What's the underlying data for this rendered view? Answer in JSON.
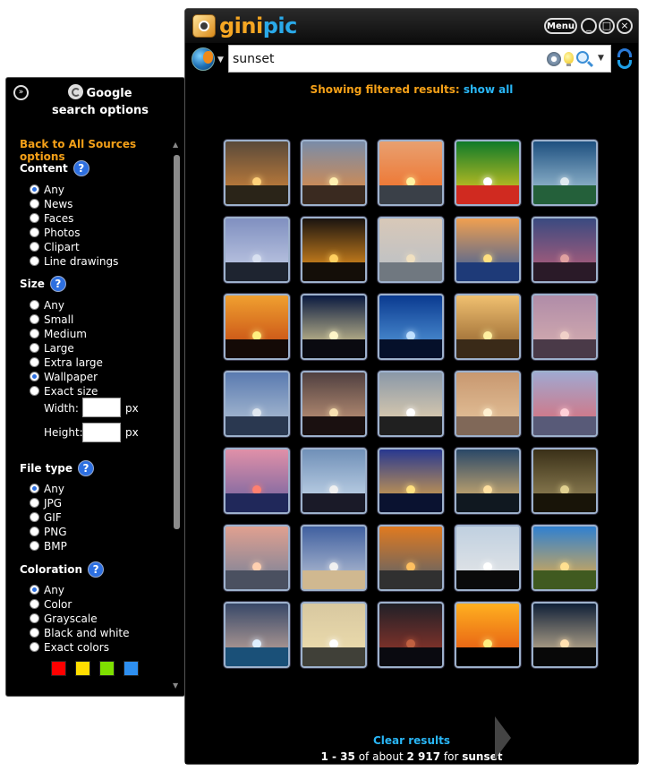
{
  "app": {
    "brand_part1": "gini",
    "brand_part2": "pic",
    "menu_label": "Menu",
    "minimize_glyph": "_",
    "maximize_glyph": "□",
    "close_glyph": "×"
  },
  "search": {
    "query": "sunset",
    "placeholder": ""
  },
  "results": {
    "filter_text": "Showing filtered results: ",
    "show_all": "show all",
    "clear_results": "Clear results",
    "summary_prefix": "1 - 35",
    "summary_middle": " of about ",
    "summary_count": "2 917",
    "summary_for": " for ",
    "summary_query": "sunset",
    "thumbnails": [
      {
        "sky": [
          "#5a4a3a",
          "#d9893b"
        ],
        "fg": "#2a2418",
        "sun": "#ffd27a"
      },
      {
        "sky": [
          "#7a8ca8",
          "#e88a3a"
        ],
        "fg": "#3a2a20",
        "sun": "#fff0b0"
      },
      {
        "sky": [
          "#e8a070",
          "#f06a20"
        ],
        "fg": "#3a4048",
        "sun": "#fff2a0"
      },
      {
        "sky": [
          "#0f7a2a",
          "#f0d020"
        ],
        "fg": "#d02a20",
        "sun": "#ffffff"
      },
      {
        "sky": [
          "#1e5080",
          "#b0d0e0"
        ],
        "fg": "#24603a",
        "sun": "#dfeaf0"
      },
      {
        "sky": [
          "#8090c0",
          "#c8d0e8"
        ],
        "fg": "#1e2430",
        "sun": "#d8e0f0"
      },
      {
        "sky": [
          "#1a1410",
          "#ffa020"
        ],
        "fg": "#140e08",
        "sun": "#ffd060"
      },
      {
        "sky": [
          "#d8c8b8",
          "#b8c0c8"
        ],
        "fg": "#707880",
        "sun": "#f0e0c0"
      },
      {
        "sky": [
          "#f0a050",
          "#2f5aa0"
        ],
        "fg": "#1e3a78",
        "sun": "#ffe080"
      },
      {
        "sky": [
          "#3a4a80",
          "#c0607a"
        ],
        "fg": "#2a1a28",
        "sun": "#e0a0a0"
      },
      {
        "sky": [
          "#f0a030",
          "#c04010"
        ],
        "fg": "#140a06",
        "sun": "#fff080"
      },
      {
        "sky": [
          "#0a1a40",
          "#f0e0a0"
        ],
        "fg": "#0a0a10",
        "sun": "#fff6c8"
      },
      {
        "sky": [
          "#0a3a90",
          "#5aa0e0"
        ],
        "fg": "#05102a",
        "sun": "#c0e0ff"
      },
      {
        "sky": [
          "#f0c070",
          "#8a5a28"
        ],
        "fg": "#3a2a18",
        "sun": "#fff0a0"
      },
      {
        "sky": [
          "#b08ca8",
          "#d8b0b0"
        ],
        "fg": "#4a3a48",
        "sun": "#f0d0c8"
      },
      {
        "sky": [
          "#5a7ab0",
          "#b8c8d8"
        ],
        "fg": "#2a3850",
        "sun": "#e0e8f0"
      },
      {
        "sky": [
          "#504040",
          "#d0a080"
        ],
        "fg": "#1a1010",
        "sun": "#f8e0b0"
      },
      {
        "sky": [
          "#8a98a8",
          "#f0d8b0"
        ],
        "fg": "#202020",
        "sun": "#ffffff"
      },
      {
        "sky": [
          "#c89870",
          "#e8c8a0"
        ],
        "fg": "#806858",
        "sun": "#fff0d0"
      },
      {
        "sky": [
          "#a0a8d0",
          "#e06870"
        ],
        "fg": "#585a78",
        "sun": "#ffd0d8"
      },
      {
        "sky": [
          "#e090a8",
          "#6a60a0"
        ],
        "fg": "#20285a",
        "sun": "#ff8070"
      },
      {
        "sky": [
          "#7090b8",
          "#d0e0f0"
        ],
        "fg": "#1a1a28",
        "sun": "#f0f0f0"
      },
      {
        "sky": [
          "#283890",
          "#f0b040"
        ],
        "fg": "#0a1230",
        "sun": "#ffe080"
      },
      {
        "sky": [
          "#2a4868",
          "#f0c070"
        ],
        "fg": "#101820",
        "sun": "#ffe0a0"
      },
      {
        "sky": [
          "#3a3018",
          "#a09060"
        ],
        "fg": "#181408",
        "sun": "#e0d090"
      },
      {
        "sky": [
          "#e0a090",
          "#70809a"
        ],
        "fg": "#4a5060",
        "sun": "#ffd0b0"
      },
      {
        "sky": [
          "#4060a0",
          "#c0c8d8"
        ],
        "fg": "#d0b890",
        "sun": "#f0f0f0"
      },
      {
        "sky": [
          "#e07a20",
          "#506070"
        ],
        "fg": "#303030",
        "sun": "#ffc060"
      },
      {
        "sky": [
          "#c0d0e0",
          "#e8e8e8"
        ],
        "fg": "#0a0a0a",
        "sun": "#ffffff"
      },
      {
        "sky": [
          "#3080d0",
          "#f0b040"
        ],
        "fg": "#405a20",
        "sun": "#ffe090"
      },
      {
        "sky": [
          "#384868",
          "#d0b0a0"
        ],
        "fg": "#1a5078",
        "sun": "#e0f0ff"
      },
      {
        "sky": [
          "#d8c8a0",
          "#f0e0b0"
        ],
        "fg": "#404038",
        "sun": "#ffffff"
      },
      {
        "sky": [
          "#202028",
          "#a0382a"
        ],
        "fg": "#0a0a10",
        "sun": "#c06040"
      },
      {
        "sky": [
          "#ffb020",
          "#e04a10"
        ],
        "fg": "#000000",
        "sun": "#fff080"
      },
      {
        "sky": [
          "#102038",
          "#e0c8a0"
        ],
        "fg": "#080808",
        "sun": "#ffe0b0"
      }
    ]
  },
  "panel": {
    "header_line1": "Google",
    "header_line2": "search options",
    "back_link": "Back to All Sources options",
    "content_title": "Content",
    "content_options": [
      "Any",
      "News",
      "Faces",
      "Photos",
      "Clipart",
      "Line drawings"
    ],
    "content_selected": "Any",
    "size_title": "Size",
    "size_options": [
      "Any",
      "Small",
      "Medium",
      "Large",
      "Extra large",
      "Wallpaper",
      "Exact size"
    ],
    "size_selected": "Wallpaper",
    "width_label": "Width:",
    "height_label": "Height:",
    "unit_px": "px",
    "filetype_title": "File type",
    "filetype_options": [
      "Any",
      "JPG",
      "GIF",
      "PNG",
      "BMP"
    ],
    "filetype_selected": "Any",
    "coloration_title": "Coloration",
    "coloration_options": [
      "Any",
      "Color",
      "Grayscale",
      "Black and white",
      "Exact colors"
    ],
    "coloration_selected": "Any",
    "help_glyph": "?",
    "color_swatches": [
      "#ff0000",
      "#ffdd00",
      "#7ee000",
      "#2e8ff0"
    ]
  }
}
